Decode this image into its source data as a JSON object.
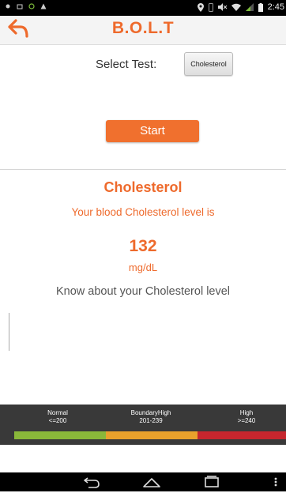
{
  "status_bar": {
    "time": "2:45",
    "left_icons": [
      "notification-icon",
      "storage-icon",
      "sync-icon",
      "warning-icon"
    ],
    "right_icons": [
      "location-icon",
      "vibrate-icon",
      "mute-icon",
      "wifi-icon",
      "signal-icon",
      "battery-icon"
    ]
  },
  "app_bar": {
    "title": "B.O.L.T",
    "back_icon": "back-arrow-icon",
    "accent_color": "#ee6a2c"
  },
  "test_selector": {
    "label": "Select Test:",
    "selected": "Cholesterol"
  },
  "start_button": {
    "label": "Start",
    "color": "#f0702e"
  },
  "result": {
    "title": "Cholesterol",
    "subtitle": "Your blood Cholesterol level is",
    "value": "132",
    "unit": "mg/dL",
    "info_link": "Know about your Cholesterol level"
  },
  "ranges": [
    {
      "name": "Normal",
      "range": "<=200",
      "color": "#8ab83a"
    },
    {
      "name": "BoundaryHigh",
      "range": "201-239",
      "color": "#e9a12c"
    },
    {
      "name": "High",
      "range": ">=240",
      "color": "#c6262e"
    }
  ],
  "nav_bar": {
    "icons": [
      "back-nav-icon",
      "home-nav-icon",
      "recents-nav-icon",
      "menu-nav-icon"
    ]
  }
}
